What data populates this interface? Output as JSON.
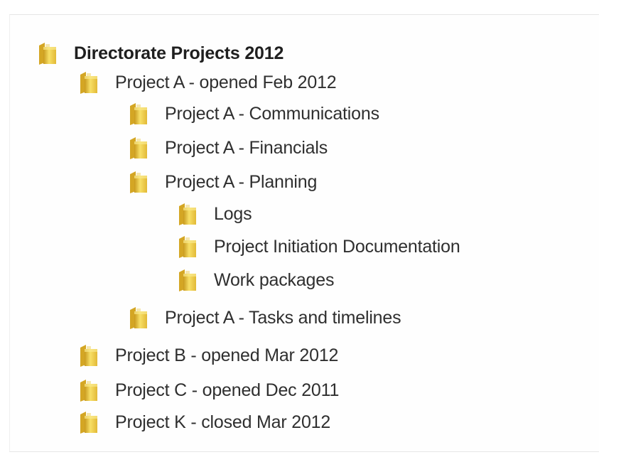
{
  "tree": {
    "root": {
      "label": "Directorate Projects 2012",
      "icon": "folder-icon"
    },
    "project_a": {
      "label": "Project A - opened Feb 2012",
      "icon": "folder-icon",
      "children": {
        "communications": {
          "label": "Project A - Communications",
          "icon": "folder-icon"
        },
        "financials": {
          "label": "Project A - Financials",
          "icon": "folder-icon"
        },
        "planning": {
          "label": "Project A - Planning",
          "icon": "folder-icon",
          "children": {
            "logs": {
              "label": "Logs",
              "icon": "folder-icon"
            },
            "pid": {
              "label": "Project Initiation Documentation",
              "icon": "folder-icon"
            },
            "work_packages": {
              "label": "Work packages",
              "icon": "folder-icon"
            }
          }
        },
        "tasks": {
          "label": "Project A - Tasks and timelines",
          "icon": "folder-icon"
        }
      }
    },
    "project_b": {
      "label": "Project B - opened Mar 2012",
      "icon": "folder-icon"
    },
    "project_c": {
      "label": "Project C - opened Dec 2011",
      "icon": "folder-icon"
    },
    "project_k": {
      "label": "Project K - closed Mar 2012",
      "icon": "folder-icon"
    }
  },
  "colors": {
    "folder_front": "#f2d44a",
    "folder_back": "#d9a826",
    "text": "#2f2f2f"
  }
}
